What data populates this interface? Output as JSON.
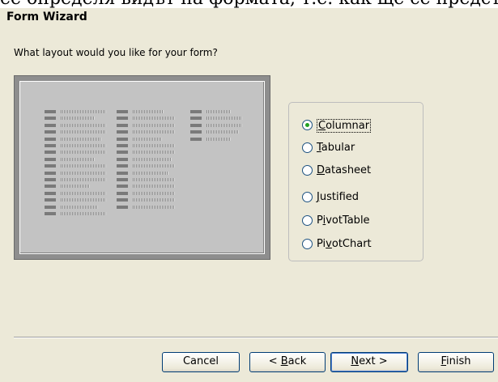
{
  "top_strip_text": "ее определя видът на формата, т.е. как ще се представя",
  "window": {
    "title": "Form Wizard"
  },
  "prompt": "What layout would you like for your form?",
  "preview": {
    "description_icon": "columnar-layout-preview"
  },
  "layout_options": [
    {
      "pre": "",
      "key": "C",
      "post": "olumnar",
      "selected": true,
      "focused": true
    },
    {
      "pre": "",
      "key": "T",
      "post": "abular",
      "selected": false,
      "focused": false
    },
    {
      "pre": "",
      "key": "D",
      "post": "atasheet",
      "selected": false,
      "focused": false
    },
    {
      "pre": "",
      "key": "J",
      "post": "ustified",
      "selected": false,
      "focused": false
    },
    {
      "pre": "P",
      "key": "i",
      "post": "votTable",
      "selected": false,
      "focused": false
    },
    {
      "pre": "Pi",
      "key": "v",
      "post": "otChart",
      "selected": false,
      "focused": false
    }
  ],
  "buttons": {
    "cancel": {
      "label": "Cancel"
    },
    "back": {
      "pre": "< ",
      "key": "B",
      "post": "ack"
    },
    "next": {
      "pre": "",
      "key": "N",
      "post": "ext >"
    },
    "finish": {
      "pre": "",
      "key": "F",
      "post": "inish"
    }
  },
  "colors": {
    "dialog_bg": "#ece9d8",
    "preview_frame": "#8e8e8e",
    "preview_bg": "#c3c3c3",
    "radio_dot": "#21a121",
    "button_border": "#003c74"
  }
}
